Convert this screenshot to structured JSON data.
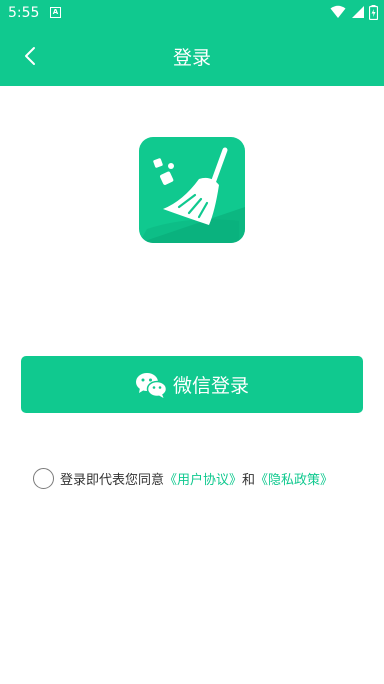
{
  "status": {
    "time": "5:55",
    "notification_glyph": "A"
  },
  "appbar": {
    "title": "登录",
    "back_icon": "chevron-left-icon"
  },
  "logo": {
    "icon": "broom-icon"
  },
  "login": {
    "wechat_label": "微信登录",
    "wechat_icon": "wechat-icon"
  },
  "agreement": {
    "prefix": "登录即代表您同意",
    "user_agreement": "《用户协议》",
    "conjunction": "和",
    "privacy_policy": "《隐私政策》"
  },
  "colors": {
    "accent": "#10c98f",
    "background": "#ffffff",
    "text": "#333333"
  }
}
